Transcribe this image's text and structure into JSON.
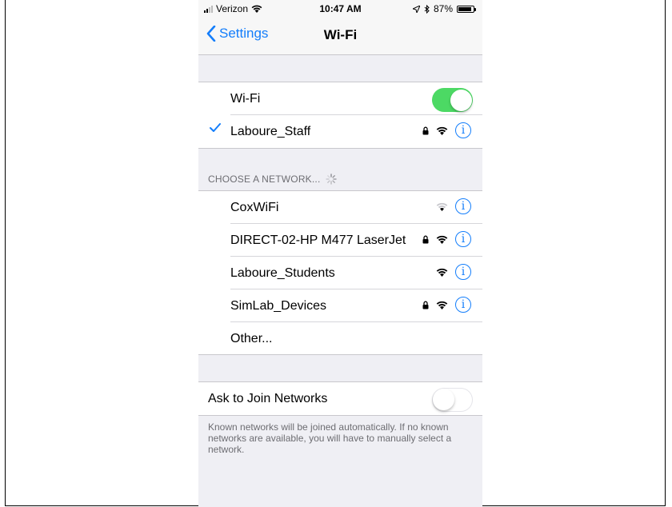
{
  "status_bar": {
    "carrier": "Verizon",
    "time": "10:47 AM",
    "battery": "87%",
    "battery_level": 0.87,
    "icons": [
      "signal-bars-icon",
      "wifi-icon",
      "location-arrow-icon",
      "bluetooth-icon",
      "battery-icon"
    ]
  },
  "nav": {
    "back_label": "Settings",
    "title": "Wi-Fi"
  },
  "wifi": {
    "label": "Wi-Fi",
    "enabled": true,
    "connected_network": "Laboure_Staff"
  },
  "choose_header": "CHOOSE A NETWORK...",
  "networks": [
    {
      "name": "CoxWiFi",
      "secured": false,
      "signal": "weak"
    },
    {
      "name": "DIRECT-02-HP M477 LaserJet",
      "secured": true,
      "signal": "full"
    },
    {
      "name": "Laboure_Students",
      "secured": false,
      "signal": "full"
    },
    {
      "name": "SimLab_Devices",
      "secured": true,
      "signal": "full"
    }
  ],
  "other_label": "Other...",
  "ask_to_join": {
    "label": "Ask to Join Networks",
    "enabled": false,
    "footer": "Known networks will be joined automatically. If no known networks are available, you will have to manually select a network."
  },
  "colors": {
    "accent": "#147efb",
    "toggle_on": "#4cd964",
    "background": "#efeff4"
  }
}
